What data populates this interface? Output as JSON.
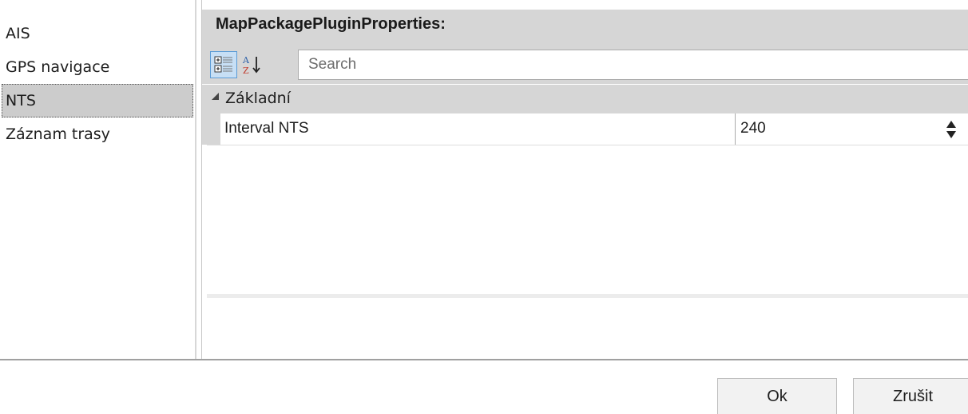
{
  "sidebar": {
    "items": [
      {
        "label": "AIS"
      },
      {
        "label": "GPS navigace"
      },
      {
        "label": "NTS"
      },
      {
        "label": "Záznam trasy"
      }
    ],
    "selected_label": "NTS"
  },
  "property_grid": {
    "title": "MapPackagePluginProperties:",
    "toolbar": {
      "categorized_icon": "categorized-view-icon",
      "alphabetical_icon": "sort-alphabetical-icon"
    },
    "search": {
      "value": "",
      "placeholder": "Search"
    },
    "category": {
      "label": "Základní",
      "expanded": true
    },
    "properties": [
      {
        "name": "Interval NTS",
        "value": "240"
      }
    ]
  },
  "buttons": {
    "ok_label": "Ok",
    "cancel_label": "Zrušit"
  },
  "colors": {
    "header_bg": "#d6d6d6",
    "selection_bg": "#cccccc",
    "active_tool_bg": "#c7dff5",
    "active_tool_border": "#5b9bd5"
  }
}
